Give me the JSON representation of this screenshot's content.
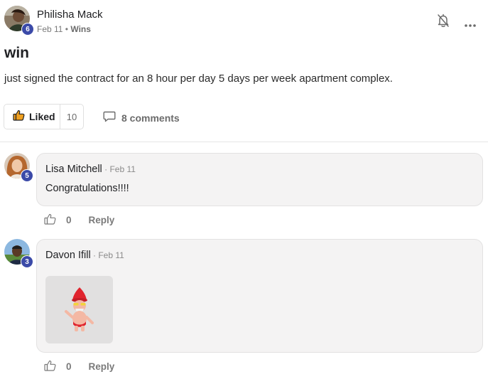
{
  "post": {
    "author": "Philisha Mack",
    "author_level": "6",
    "date": "Feb 11",
    "separator": " • ",
    "category": "Wins",
    "title": "win",
    "body": "just signed the contract for an 8 hour per day 5 days per week apartment complex.",
    "like_label": "Liked",
    "like_count": "10",
    "comments_label": "8 comments"
  },
  "comments": [
    {
      "author": "Lisa Mitchell",
      "level": "5",
      "time": " · Feb 11",
      "text": "Congratulations!!!!",
      "likes": "0",
      "reply_label": "Reply"
    },
    {
      "author": "Davon Ifill",
      "level": "3",
      "time": " · Feb 11",
      "attachment": "sticker",
      "likes": "0",
      "reply_label": "Reply"
    }
  ],
  "icons": {
    "notifications": "bell-off-icon",
    "more": "more-horizontal-icon",
    "like": "thumbs-up-icon",
    "comment": "comment-icon"
  },
  "colors": {
    "badge": "#3b4aa8",
    "liked_thumb": "#f0a020",
    "bubble": "#f4f3f3"
  }
}
